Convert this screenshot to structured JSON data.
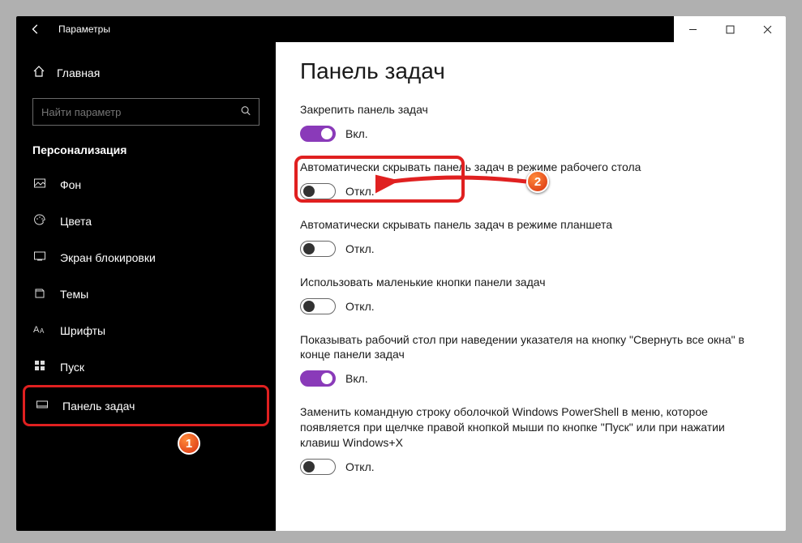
{
  "window": {
    "title": "Параметры"
  },
  "sidebar": {
    "home_label": "Главная",
    "search_placeholder": "Найти параметр",
    "section_label": "Персонализация",
    "items": [
      {
        "icon": "image-icon",
        "label": "Фон"
      },
      {
        "icon": "palette-icon",
        "label": "Цвета"
      },
      {
        "icon": "lockscreen-icon",
        "label": "Экран блокировки"
      },
      {
        "icon": "theme-icon",
        "label": "Темы"
      },
      {
        "icon": "font-icon",
        "label": "Шрифты"
      },
      {
        "icon": "start-icon",
        "label": "Пуск"
      },
      {
        "icon": "taskbar-icon",
        "label": "Панель задач"
      }
    ]
  },
  "main": {
    "heading": "Панель задач",
    "settings": [
      {
        "label": "Закрепить панель задач",
        "state": "on",
        "state_label": "Вкл."
      },
      {
        "label": "Автоматически скрывать панель задач в режиме рабочего стола",
        "state": "off",
        "state_label": "Откл."
      },
      {
        "label": "Автоматически скрывать панель задач в режиме планшета",
        "state": "off",
        "state_label": "Откл."
      },
      {
        "label": "Использовать маленькие кнопки панели задач",
        "state": "off",
        "state_label": "Откл."
      },
      {
        "label": "Показывать рабочий стол при наведении указателя на кнопку \"Свернуть все окна\" в конце панели задач",
        "state": "on",
        "state_label": "Вкл."
      },
      {
        "label": "Заменить командную строку оболочкой Windows PowerShell в меню, которое появляется при щелчке правой кнопкой мыши по кнопке \"Пуск\" или при нажатии клавиш Windows+X",
        "state": "off",
        "state_label": "Откл."
      }
    ]
  },
  "annotations": {
    "badge1": "1",
    "badge2": "2"
  }
}
